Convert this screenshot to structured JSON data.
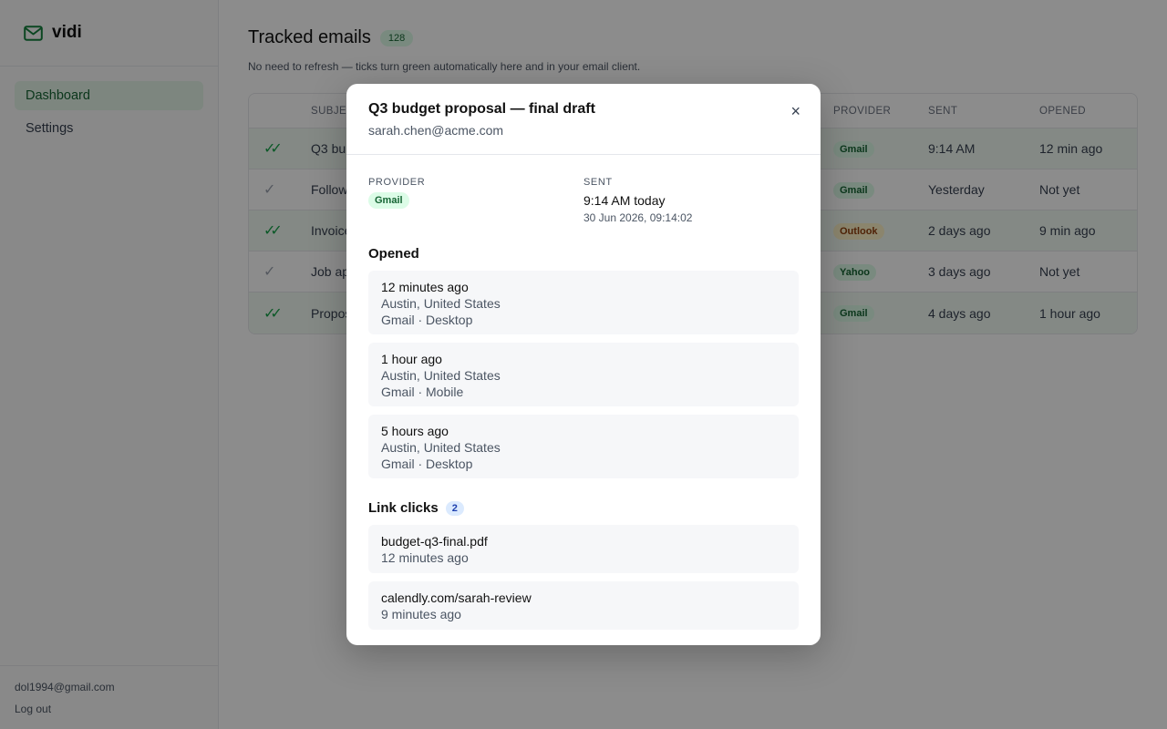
{
  "app": {
    "name": "vidi"
  },
  "sidebar": {
    "items": [
      {
        "label": "Dashboard",
        "active": true
      },
      {
        "label": "Settings",
        "active": false
      }
    ],
    "account_email": "dol1994@gmail.com",
    "logout_label": "Log out"
  },
  "main": {
    "title": "Tracked emails",
    "count": "128",
    "subtitle": "No need to refresh — ticks turn green automatically here and in your email client.",
    "columns": [
      "SUBJECT",
      "PROVIDER",
      "SENT",
      "OPENED"
    ],
    "rows": [
      {
        "subject": "Q3 budget proposal — final draft",
        "subject_visible": "Q3 bu",
        "provider": "Gmail",
        "sent": "9:14 AM",
        "opened": "12 min ago",
        "status": "opened"
      },
      {
        "subject": "Follow",
        "subject_visible": "Follow",
        "provider": "Gmail",
        "sent": "Yesterday",
        "opened": "Not yet",
        "status": "unopened"
      },
      {
        "subject": "Invoice",
        "subject_visible": "Invoice",
        "provider": "Outlook",
        "sent": "2 days ago",
        "opened": "9 min ago",
        "status": "opened"
      },
      {
        "subject": "Job ap",
        "subject_visible": "Job ap",
        "provider": "Yahoo",
        "sent": "3 days ago",
        "opened": "Not yet",
        "status": "unopened"
      },
      {
        "subject": "Propos",
        "subject_visible": "Propos",
        "provider": "Gmail",
        "sent": "4 days ago",
        "opened": "1 hour ago",
        "status": "opened"
      }
    ]
  },
  "modal": {
    "title": "Q3 budget proposal — final draft",
    "recipient": "sarah.chen@acme.com",
    "close_label": "×",
    "provider_label": "PROVIDER",
    "provider": "Gmail",
    "sent_label": "SENT",
    "sent_value": "9:14 AM today",
    "sent_full": "30 Jun 2026, 09:14:02",
    "opened_title": "Opened",
    "opens": [
      {
        "when": "12 minutes ago",
        "location": "Austin, United States",
        "client": "Gmail · Desktop"
      },
      {
        "when": "1 hour ago",
        "location": "Austin, United States",
        "client": "Gmail · Mobile"
      },
      {
        "when": "5 hours ago",
        "location": "Austin, United States",
        "client": "Gmail · Desktop"
      }
    ],
    "clicks_title": "Link clicks",
    "clicks_count": "2",
    "clicks": [
      {
        "link": "budget-q3-final.pdf",
        "when": "12 minutes ago"
      },
      {
        "link": "calendly.com/sarah-review",
        "when": "9 minutes ago"
      }
    ]
  },
  "colors": {
    "accent": "#16a34a",
    "active_nav_bg": "#e4f4e8",
    "overlay": "rgba(0,0,0,0.45)"
  },
  "icons": {
    "brand": "envelope-icon",
    "opened_tick": "double-check-icon",
    "unopened_tick": "check-icon",
    "close": "close-icon"
  }
}
